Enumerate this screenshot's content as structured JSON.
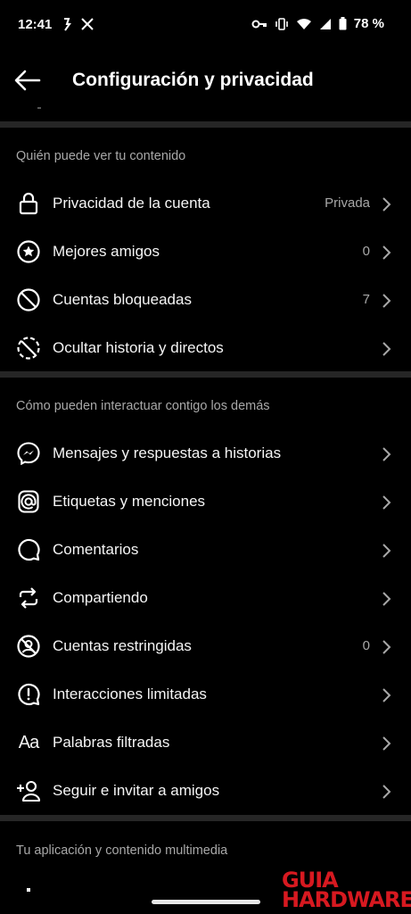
{
  "status_bar": {
    "time": "12:41",
    "battery": "78 %",
    "icons": [
      "activity-icon",
      "x-icon",
      "key-icon",
      "vibrate-icon",
      "wifi-icon",
      "signal-icon",
      "battery-icon"
    ]
  },
  "header": {
    "title": "Configuración y privacidad",
    "back_icon": "back-arrow-icon"
  },
  "sections": [
    {
      "title": "Quién puede ver tu contenido",
      "items": [
        {
          "label": "Privacidad de la cuenta",
          "value": "Privada",
          "icon": "lock-icon"
        },
        {
          "label": "Mejores amigos",
          "value": "0",
          "icon": "star-circle-icon"
        },
        {
          "label": "Cuentas bloqueadas",
          "value": "7",
          "icon": "block-icon"
        },
        {
          "label": "Ocultar historia y directos",
          "value": "",
          "icon": "hide-story-icon"
        }
      ]
    },
    {
      "title": "Cómo pueden interactuar contigo los demás",
      "items": [
        {
          "label": "Mensajes y respuestas a historias",
          "value": "",
          "icon": "messenger-icon"
        },
        {
          "label": "Etiquetas y menciones",
          "value": "",
          "icon": "at-mention-icon"
        },
        {
          "label": "Comentarios",
          "value": "",
          "icon": "comment-icon"
        },
        {
          "label": "Compartiendo",
          "value": "",
          "icon": "share-repost-icon"
        },
        {
          "label": "Cuentas restringidas",
          "value": "0",
          "icon": "restricted-icon"
        },
        {
          "label": "Interacciones limitadas",
          "value": "",
          "icon": "limited-interactions-icon"
        },
        {
          "label": "Palabras filtradas",
          "value": "",
          "icon": "text-aa-icon",
          "glyph": "Aa"
        },
        {
          "label": "Seguir e invitar a amigos",
          "value": "",
          "icon": "add-person-icon"
        }
      ]
    },
    {
      "title": "Tu aplicación y contenido multimedia",
      "items": []
    }
  ],
  "watermark": {
    "top": "GUIA",
    "bottom": "HARDWARE"
  }
}
